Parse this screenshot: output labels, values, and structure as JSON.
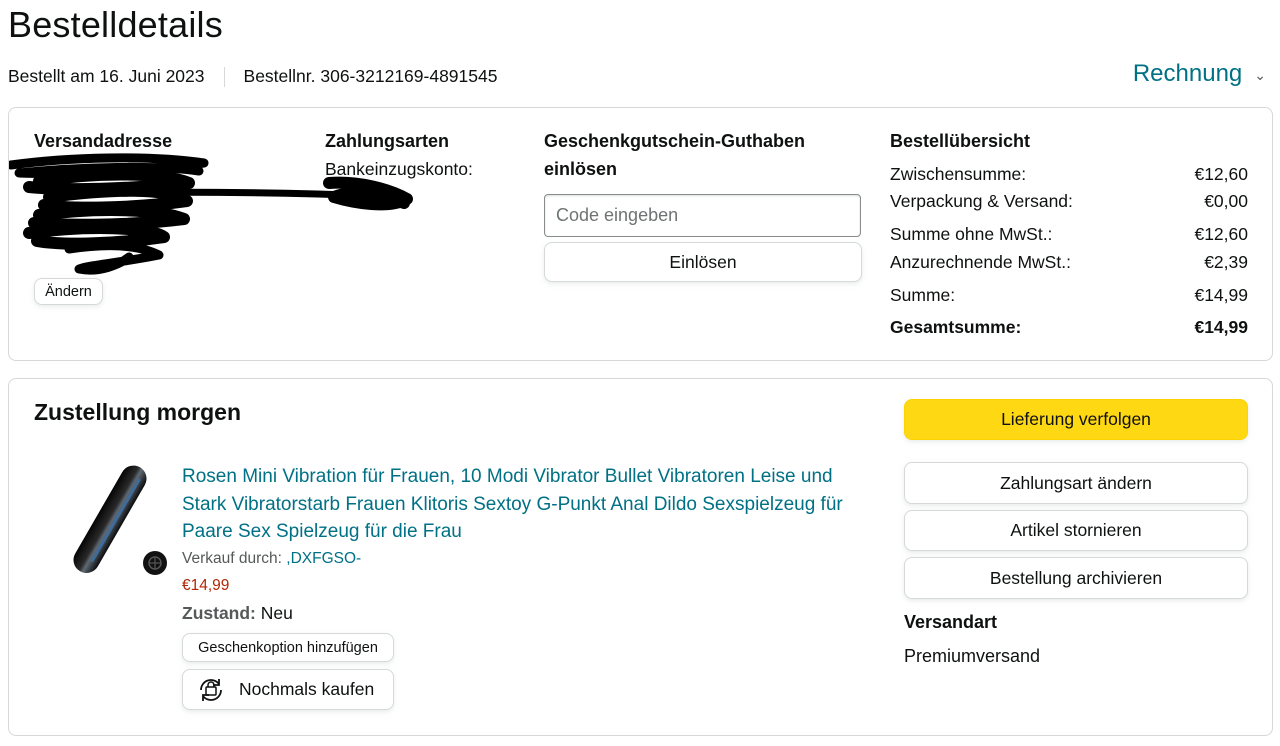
{
  "page_title": "Bestelldetails",
  "order_meta": {
    "ordered_on": "Bestellt am 16. Juni 2023",
    "order_number": "Bestellnr. 306-3212169-4891545"
  },
  "invoice": {
    "label": "Rechnung",
    "icon": "chevron-down-icon"
  },
  "shipping_address": {
    "heading": "Versandadresse",
    "change_label": "Ändern"
  },
  "payment": {
    "heading": "Zahlungsarten",
    "method": "Bankeinzugskonto:"
  },
  "gift_card": {
    "heading_line1": "Geschenkgutschein-Guthaben",
    "heading_line2": "einlösen",
    "placeholder": "Code eingeben",
    "redeem_label": "Einlösen"
  },
  "order_summary": {
    "heading": "Bestellübersicht",
    "rows": [
      {
        "label": "Zwischensumme:",
        "value": "€12,60"
      },
      {
        "label": "Verpackung & Versand:",
        "value": "€0,00"
      },
      {
        "label": "Summe ohne MwSt.:",
        "value": "€12,60"
      },
      {
        "label": "Anzurechnende MwSt.:",
        "value": "€2,39"
      },
      {
        "label": "Summe:",
        "value": "€14,99"
      },
      {
        "label": "Gesamtsumme:",
        "value": "€14,99"
      }
    ]
  },
  "delivery": {
    "heading": "Zustellung morgen",
    "product": {
      "title": "Rosen Mini Vibration für Frauen, 10 Modi Vibrator Bullet Vibratoren Leise und Stark Vibratorstarb Frauen Klitoris Sextoy G-Punkt Anal Dildo Sexspielzeug für Paare Sex Spielzeug für die Frau",
      "sold_by_label": "Verkauf durch: ",
      "seller": ",DXFGSO-",
      "price": "€14,99",
      "condition_label": "Zustand:",
      "condition_value": " Neu",
      "gift_option_label": "Geschenkoption hinzufügen",
      "buy_again_label": "Nochmals kaufen"
    },
    "actions": {
      "track": "Lieferung verfolgen",
      "change_payment": "Zahlungsart ändern",
      "cancel": "Artikel stornieren",
      "archive": "Bestellung archivieren"
    },
    "shipping_method": {
      "heading": "Versandart",
      "value": "Premiumversand"
    }
  },
  "colors": {
    "link": "#007185",
    "price": "#b12704",
    "primary_button": "#ffd814",
    "border": "#d5d9d9"
  }
}
